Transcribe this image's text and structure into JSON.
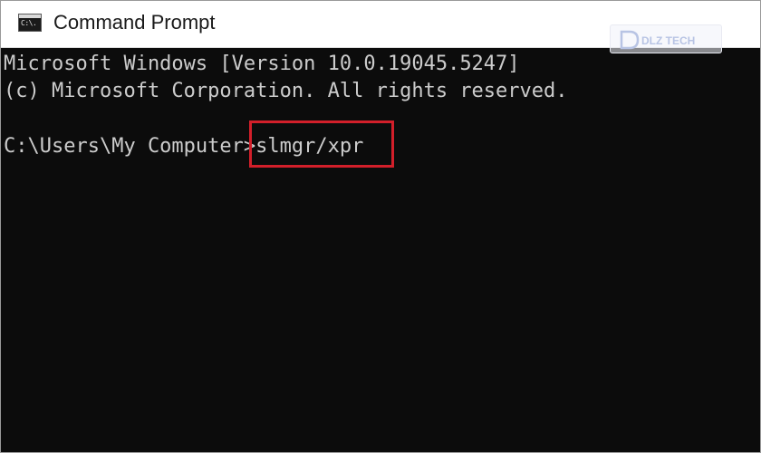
{
  "window": {
    "title": "Command Prompt",
    "icon": "cmd-console-icon",
    "icon_text": "C:\\."
  },
  "console": {
    "lines": [
      "Microsoft Windows [Version 10.0.19045.5247]",
      "(c) Microsoft Corporation. All rights reserved."
    ],
    "prompt": "C:\\Users\\My Computer>",
    "command": "slmgr/xpr"
  },
  "watermark": {
    "text": "DLZ TECH"
  },
  "colors": {
    "console_background": "#0c0c0c",
    "console_text": "#cccccc",
    "highlight_border": "#d21f2a",
    "titlebar_background": "#ffffff"
  }
}
